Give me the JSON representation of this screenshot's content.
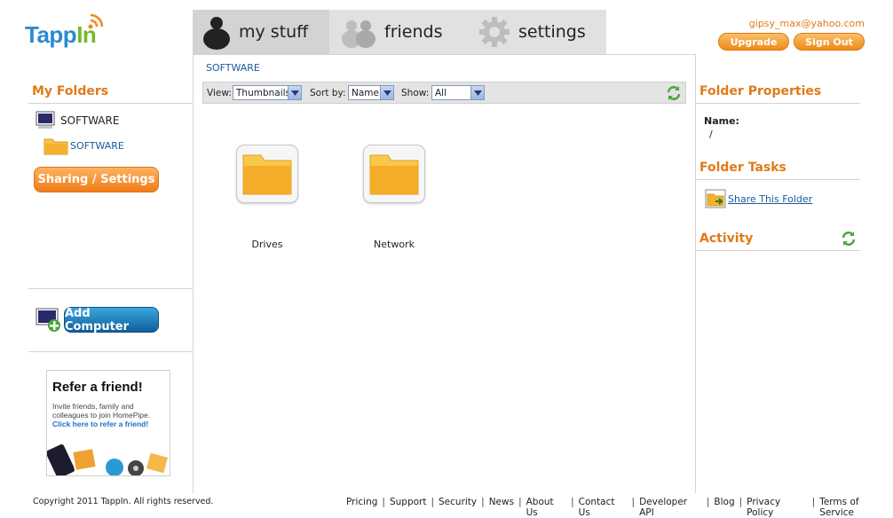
{
  "brand": {
    "logo_part1": "Tapp",
    "logo_part2": "In"
  },
  "tabs": [
    {
      "label": "my stuff",
      "icon": "person-icon",
      "active": true
    },
    {
      "label": "friends",
      "icon": "friends-icon",
      "active": false
    },
    {
      "label": "settings",
      "icon": "gear-icon",
      "active": false
    }
  ],
  "account": {
    "email": "gipsy_max@yahoo.com",
    "upgrade_label": "Upgrade",
    "signout_label": "Sign Out"
  },
  "left": {
    "title": "My Folders",
    "computer_name": "SOFTWARE",
    "folder_name": "SOFTWARE",
    "sharing_button": "Sharing / Settings",
    "add_computer_button": "Add Computer",
    "ad": {
      "title": "Refer a friend!",
      "line1": "Invite friends, family and colleagues to join HomePipe.",
      "link": "Click here to refer a friend!"
    }
  },
  "main": {
    "breadcrumb": "SOFTWARE",
    "toolbar": {
      "view_label": "View:",
      "view_value": "Thumbnails",
      "sort_label": "Sort by:",
      "sort_value": "Name",
      "show_label": "Show:",
      "show_value": "All"
    },
    "items": [
      {
        "name": "Drives"
      },
      {
        "name": "Network"
      }
    ]
  },
  "right": {
    "properties_title": "Folder Properties",
    "name_label": "Name:",
    "name_value": "/",
    "tasks_title": "Folder Tasks",
    "share_link": "Share This Folder",
    "activity_title": "Activity"
  },
  "footer": {
    "copyright": "Copyright 2011 TappIn. All rights reserved.",
    "links": [
      "Pricing",
      "Support",
      "Security",
      "News",
      "About Us",
      "Contact Us",
      "Developer API",
      "Blog",
      "Privacy Policy",
      "Terms of Service"
    ]
  },
  "colors": {
    "accent_orange": "#e07a18",
    "link_blue": "#1a5a9a",
    "button_blue": "#105f9a"
  }
}
